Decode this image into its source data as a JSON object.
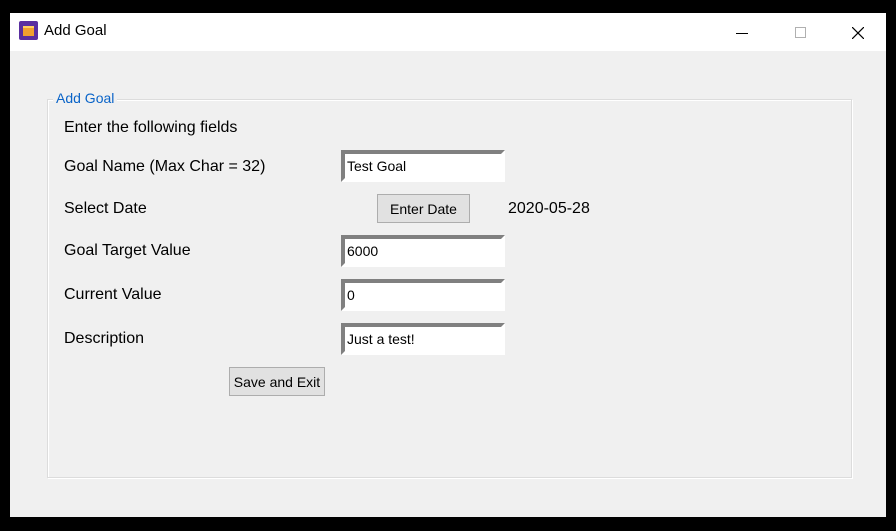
{
  "window": {
    "title": "Add Goal",
    "controls": {
      "minimize_icon": "minimize-icon",
      "maximize_icon": "maximize-icon",
      "close_icon": "close-icon"
    }
  },
  "group": {
    "legend": "Add Goal",
    "legend_color": "#0a64c8",
    "instructions": "Enter the following fields"
  },
  "form": {
    "goal_name": {
      "label": "Goal Name (Max Char = 32)",
      "value": "Test Goal"
    },
    "date": {
      "label": "Select Date",
      "button_label": "Enter Date",
      "value": "2020-05-28"
    },
    "target": {
      "label": "Goal Target Value",
      "value": "6000"
    },
    "current": {
      "label": "Current Value",
      "value": "0"
    },
    "description": {
      "label": "Description",
      "value": "Just a test!"
    },
    "save_label": "Save and Exit"
  }
}
